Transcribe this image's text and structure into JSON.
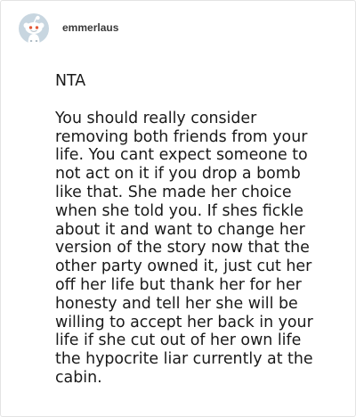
{
  "post": {
    "username": "emmerlaus",
    "avatar_icon": "reddit-snoo-avatar-icon",
    "paragraphs": [
      "NTA",
      "You should really consider\nremoving both friends from your\nlife. You cant expect someone to\nnot act on it if you drop a bomb\nlike that. She made her choice\nwhen she told you. If shes fickle\nabout it and want to change her\nversion of the story now that the\nother party owned it, just cut her\noff her life but thank her for her\nhonesty and tell her she will be\nwilling to accept her back in your\nlife if she cut out of her own life\nthe hypocrite liar currently at the\ncabin."
    ]
  },
  "colors": {
    "text": "#1a1a1a",
    "username": "#3a3a3a",
    "avatar_bg": "#c8d6e0",
    "border": "#e3e3e3"
  }
}
